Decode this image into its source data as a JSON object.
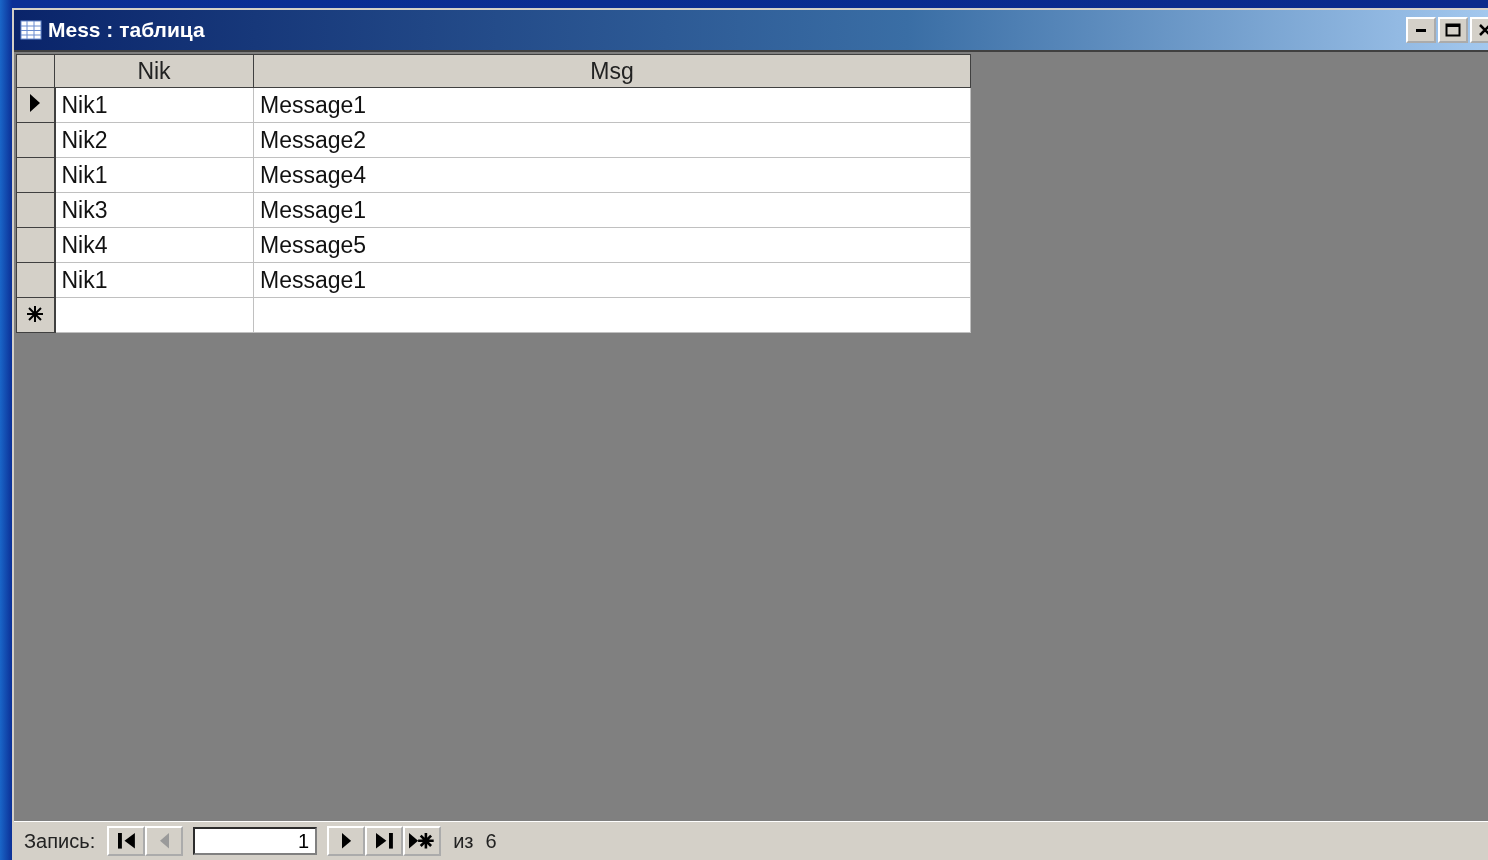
{
  "window": {
    "title": "Mess : таблица"
  },
  "table": {
    "columns": [
      "Nik",
      "Msg"
    ],
    "rows": [
      {
        "kind": "record",
        "selected": true,
        "cells": [
          "Nik1",
          "Message1"
        ]
      },
      {
        "kind": "record",
        "selected": false,
        "cells": [
          "Nik2",
          "Message2"
        ]
      },
      {
        "kind": "record",
        "selected": false,
        "cells": [
          "Nik1",
          "Message4"
        ]
      },
      {
        "kind": "record",
        "selected": false,
        "cells": [
          "Nik3",
          "Message1"
        ]
      },
      {
        "kind": "record",
        "selected": false,
        "cells": [
          "Nik4",
          "Message5"
        ]
      },
      {
        "kind": "record",
        "selected": false,
        "cells": [
          "Nik1",
          "Message1"
        ]
      },
      {
        "kind": "new",
        "selected": false,
        "cells": [
          "",
          ""
        ]
      }
    ]
  },
  "navigator": {
    "label": "Запись:",
    "record_number": "1",
    "of_label": "из",
    "total": "6",
    "buttons_before": [
      {
        "kind": "first",
        "disabled": false
      },
      {
        "kind": "prev",
        "disabled": true
      }
    ],
    "buttons_after": [
      {
        "kind": "next",
        "disabled": false
      },
      {
        "kind": "last",
        "disabled": false
      },
      {
        "kind": "new",
        "disabled": false
      }
    ]
  }
}
